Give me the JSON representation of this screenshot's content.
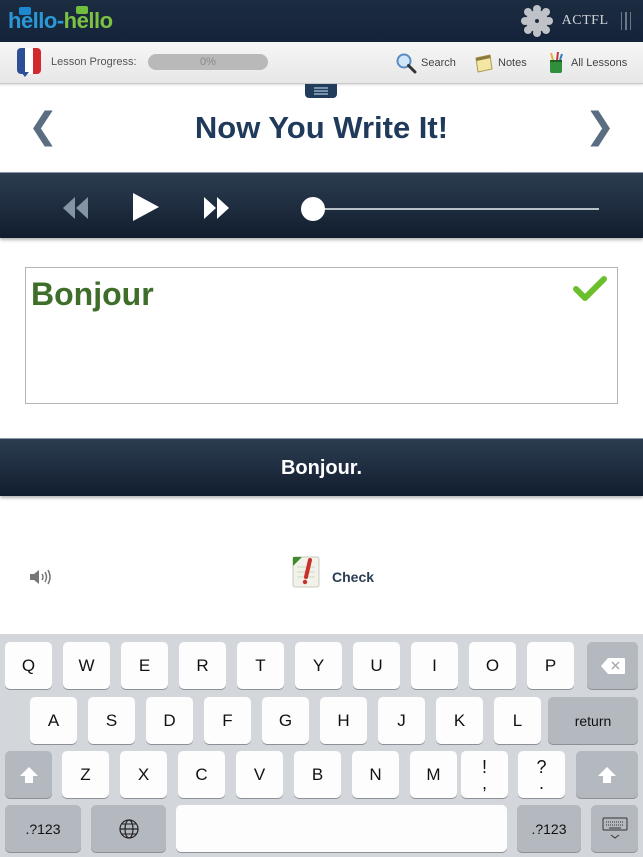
{
  "header": {
    "logo_part1": "hello",
    "logo_dash": "-",
    "logo_part2": "hello",
    "partner": "ACTFL"
  },
  "toolbar": {
    "progress_label": "Lesson Progress:",
    "progress_value": 0,
    "progress_text": "0%",
    "search_label": "Search",
    "notes_label": "Notes",
    "all_lessons_label": "All Lessons"
  },
  "lesson": {
    "title": "Now You Write It!",
    "prev_glyph": "❮",
    "next_glyph": "❯"
  },
  "player": {
    "position_fraction": 0
  },
  "answer": {
    "typed_text": "Bonjour",
    "is_correct": true,
    "correct_answer": "Bonjour."
  },
  "actions": {
    "check_label": "Check"
  },
  "colors": {
    "header_bg": "#14233a",
    "title": "#1f3a5a",
    "answer_green": "#3e6e2a",
    "check_green": "#7cc242",
    "logo_blue": "#2b98d6",
    "logo_green": "#7cc242"
  },
  "keyboard": {
    "row1": [
      "Q",
      "W",
      "E",
      "R",
      "T",
      "Y",
      "U",
      "I",
      "O",
      "P"
    ],
    "row2": [
      "A",
      "S",
      "D",
      "F",
      "G",
      "H",
      "J",
      "K",
      "L"
    ],
    "row3": [
      "Z",
      "X",
      "C",
      "V",
      "B",
      "N",
      "M"
    ],
    "punct1_top": "!",
    "punct1_bottom": ",",
    "punct2_top": "?",
    "punct2_bottom": ".",
    "return_label": "return",
    "numbers_label": ".?123"
  }
}
